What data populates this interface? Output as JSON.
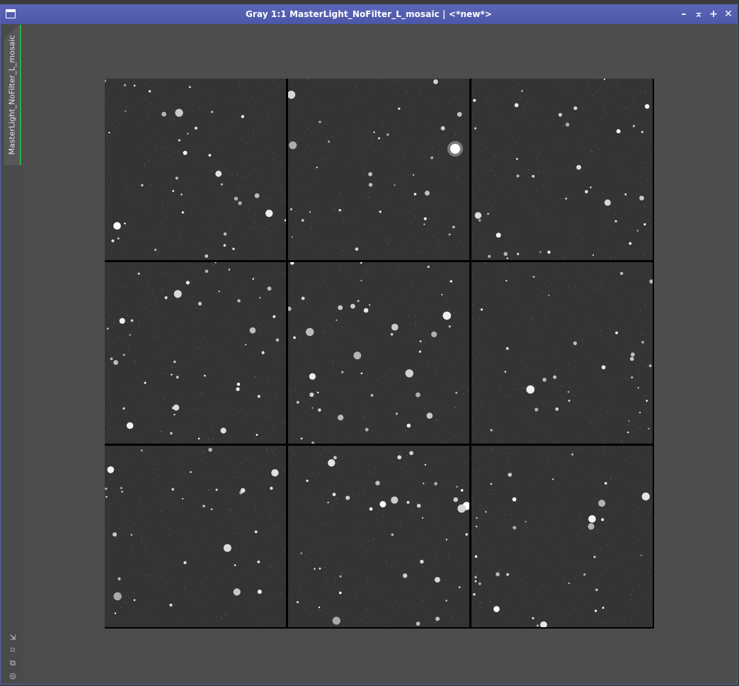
{
  "window": {
    "title": "Gray 1:1 MasterLight_NoFilter_L_mosaic | <*new*>",
    "minimize_glyph": "–",
    "shade_glyph": "⌅",
    "maximize_glyph": "+",
    "close_glyph": "✕"
  },
  "sidebar": {
    "tab_label": "MasterLight_NoFilter_L_mosaic",
    "icons": [
      "resize-icon",
      "fit-view-icon",
      "clone-icon",
      "target-icon"
    ]
  },
  "image": {
    "rows": 3,
    "cols": 3
  },
  "colors": {
    "title_bar": "#5560b0",
    "tab_accent": "#2fb24a",
    "background": "#4d4d4d",
    "sky": "#343434"
  }
}
